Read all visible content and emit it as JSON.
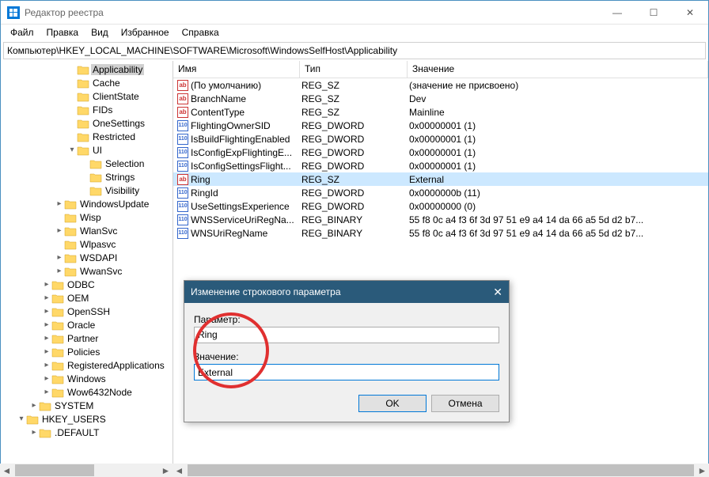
{
  "window": {
    "title": "Редактор реестра"
  },
  "menu": {
    "file": "Файл",
    "edit": "Правка",
    "view": "Вид",
    "favorites": "Избранное",
    "help": "Справка"
  },
  "address": "Компьютер\\HKEY_LOCAL_MACHINE\\SOFTWARE\\Microsoft\\WindowsSelfHost\\Applicability",
  "columns": {
    "name": "Имя",
    "type": "Тип",
    "value": "Значение"
  },
  "tree": [
    {
      "depth": 4,
      "exp": "",
      "label": "Applicability",
      "selected": true
    },
    {
      "depth": 4,
      "exp": "",
      "label": "Cache"
    },
    {
      "depth": 4,
      "exp": "",
      "label": "ClientState"
    },
    {
      "depth": 4,
      "exp": "",
      "label": "FIDs"
    },
    {
      "depth": 4,
      "exp": "",
      "label": "OneSettings"
    },
    {
      "depth": 4,
      "exp": "",
      "label": "Restricted"
    },
    {
      "depth": 4,
      "exp": "v",
      "label": "UI"
    },
    {
      "depth": 5,
      "exp": "",
      "label": "Selection"
    },
    {
      "depth": 5,
      "exp": "",
      "label": "Strings"
    },
    {
      "depth": 5,
      "exp": "",
      "label": "Visibility"
    },
    {
      "depth": 3,
      "exp": ">",
      "label": "WindowsUpdate"
    },
    {
      "depth": 3,
      "exp": "",
      "label": "Wisp"
    },
    {
      "depth": 3,
      "exp": ">",
      "label": "WlanSvc"
    },
    {
      "depth": 3,
      "exp": "",
      "label": "Wlpasvc"
    },
    {
      "depth": 3,
      "exp": ">",
      "label": "WSDAPI"
    },
    {
      "depth": 3,
      "exp": ">",
      "label": "WwanSvc"
    },
    {
      "depth": 2,
      "exp": ">",
      "label": "ODBC"
    },
    {
      "depth": 2,
      "exp": ">",
      "label": "OEM"
    },
    {
      "depth": 2,
      "exp": ">",
      "label": "OpenSSH"
    },
    {
      "depth": 2,
      "exp": ">",
      "label": "Oracle"
    },
    {
      "depth": 2,
      "exp": ">",
      "label": "Partner"
    },
    {
      "depth": 2,
      "exp": ">",
      "label": "Policies"
    },
    {
      "depth": 2,
      "exp": ">",
      "label": "RegisteredApplications"
    },
    {
      "depth": 2,
      "exp": ">",
      "label": "Windows"
    },
    {
      "depth": 2,
      "exp": ">",
      "label": "Wow6432Node"
    },
    {
      "depth": 1,
      "exp": ">",
      "label": "SYSTEM"
    },
    {
      "depth": 0,
      "exp": "v",
      "label": "HKEY_USERS"
    },
    {
      "depth": 1,
      "exp": ">",
      "label": ".DEFAULT"
    }
  ],
  "values": [
    {
      "icon": "sz",
      "name": "(По умолчанию)",
      "type": "REG_SZ",
      "value": "(значение не присвоено)"
    },
    {
      "icon": "sz",
      "name": "BranchName",
      "type": "REG_SZ",
      "value": "Dev"
    },
    {
      "icon": "sz",
      "name": "ContentType",
      "type": "REG_SZ",
      "value": "Mainline"
    },
    {
      "icon": "bin",
      "name": "FlightingOwnerSID",
      "type": "REG_DWORD",
      "value": "0x00000001 (1)"
    },
    {
      "icon": "bin",
      "name": "IsBuildFlightingEnabled",
      "type": "REG_DWORD",
      "value": "0x00000001 (1)"
    },
    {
      "icon": "bin",
      "name": "IsConfigExpFlightingE...",
      "type": "REG_DWORD",
      "value": "0x00000001 (1)"
    },
    {
      "icon": "bin",
      "name": "IsConfigSettingsFlight...",
      "type": "REG_DWORD",
      "value": "0x00000001 (1)"
    },
    {
      "icon": "sz",
      "name": "Ring",
      "type": "REG_SZ",
      "value": "External",
      "selected": true
    },
    {
      "icon": "bin",
      "name": "RingId",
      "type": "REG_DWORD",
      "value": "0x0000000b (11)"
    },
    {
      "icon": "bin",
      "name": "UseSettingsExperience",
      "type": "REG_DWORD",
      "value": "0x00000000 (0)"
    },
    {
      "icon": "bin",
      "name": "WNSServiceUriRegNa...",
      "type": "REG_BINARY",
      "value": "55 f8 0c a4 f3 6f 3d 97 51 e9 a4 14 da 66 a5 5d d2 b7..."
    },
    {
      "icon": "bin",
      "name": "WNSUriRegName",
      "type": "REG_BINARY",
      "value": "55 f8 0c a4 f3 6f 3d 97 51 e9 a4 14 da 66 a5 5d d2 b7..."
    }
  ],
  "dialog": {
    "title": "Изменение строкового параметра",
    "param_label": "Параметр:",
    "param_value": "Ring",
    "value_label": "Значение:",
    "value_value": "External",
    "ok": "OK",
    "cancel": "Отмена"
  }
}
